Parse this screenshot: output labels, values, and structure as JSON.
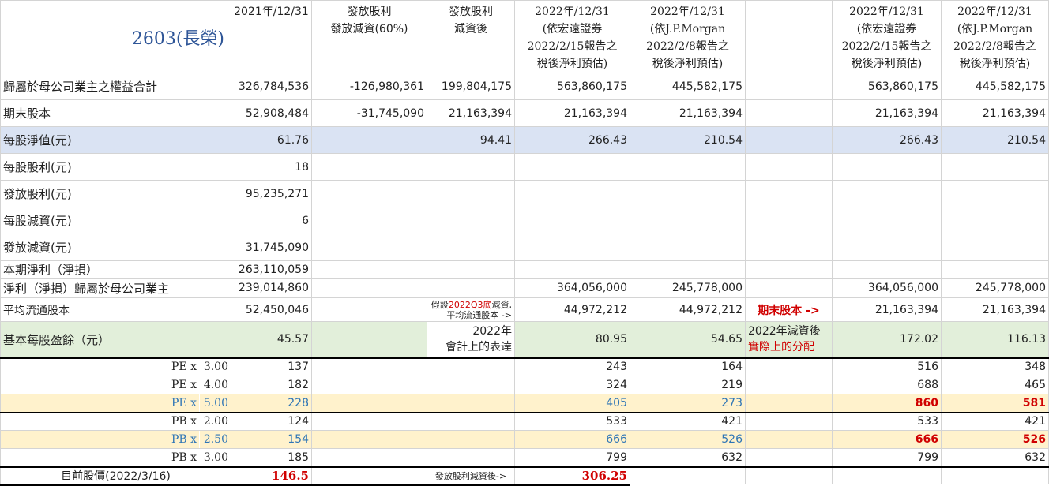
{
  "title": "2603(長榮)",
  "headers": [
    "2021年/12/31",
    "發放股利\n發放減資(60%)",
    "發放股利\n減資後",
    "2022年/12/31\n(依宏遠證券\n2022/2/15報告之\n稅後淨利預估)",
    "2022年/12/31\n(依J.P.Morgan\n2022/2/8報告之\n稅後淨利預估)",
    "",
    "2022年/12/31\n(依宏遠證券\n2022/2/15報告之\n稅後淨利預估)",
    "2022年/12/31\n(依J.P.Morgan\n2022/2/8報告之\n稅後淨利預估)"
  ],
  "rows": [
    {
      "label": "歸屬於母公司業主之權益合計",
      "cells": [
        "326,784,536",
        "-126,980,361",
        "199,804,175",
        "563,860,175",
        "445,582,175",
        "",
        "563,860,175",
        "445,582,175"
      ]
    },
    {
      "label": "期末股本",
      "cells": [
        "52,908,484",
        "-31,745,090",
        "21,163,394",
        "21,163,394",
        "21,163,394",
        "",
        "21,163,394",
        "21,163,394"
      ]
    },
    {
      "label": "每股淨值(元)",
      "cells": [
        "61.76",
        "",
        "94.41",
        "266.43",
        "210.54",
        "",
        "266.43",
        "210.54"
      ]
    },
    {
      "label": "每股股利(元)",
      "cells": [
        "18",
        "",
        "",
        "",
        "",
        "",
        "",
        ""
      ]
    },
    {
      "label": "發放股利(元)",
      "cells": [
        "95,235,271",
        "",
        "",
        "",
        "",
        "",
        "",
        ""
      ]
    },
    {
      "label": "每股減資(元)",
      "cells": [
        "6",
        "",
        "",
        "",
        "",
        "",
        "",
        ""
      ]
    },
    {
      "label": "發放減資(元)",
      "cells": [
        "31,745,090",
        "",
        "",
        "",
        "",
        "",
        "",
        ""
      ]
    },
    {
      "label": "本期淨利（淨損）",
      "cells": [
        "263,110,059",
        "",
        "",
        "",
        "",
        "",
        "",
        ""
      ]
    },
    {
      "label": "淨利（淨損）歸屬於母公司業主",
      "cells": [
        "239,014,860",
        "",
        "",
        "364,056,000",
        "245,778,000",
        "",
        "364,056,000",
        "245,778,000"
      ]
    }
  ],
  "avg_shares": {
    "label": "平均流通股本",
    "base": "52,450,046",
    "note_prefix": "假設",
    "note_red": "2022Q3底",
    "note_suffix": "減資,",
    "note_line2": "平均流通股本 ->",
    "v1": "44,972,212",
    "v2": "44,972,212",
    "end_label": "期末股本 ->",
    "v3": "21,163,394",
    "v4": "21,163,394"
  },
  "eps": {
    "label": "基本每股盈餘（元）",
    "base": "45.57",
    "note_line1": "2022年",
    "note_line2": "會計上的表達",
    "v1": "80.95",
    "v2": "54.65",
    "after_line1": "2022年減資後",
    "after_line2": "實際上的分配",
    "v3": "172.02",
    "v4": "116.13"
  },
  "pe_rows": [
    {
      "label": "PE x",
      "mult": "3.00",
      "base": "137",
      "v1": "243",
      "v2": "164",
      "v3": "516",
      "v4": "348",
      "hl": false
    },
    {
      "label": "PE x",
      "mult": "4.00",
      "base": "182",
      "v1": "324",
      "v2": "219",
      "v3": "688",
      "v4": "465",
      "hl": false
    },
    {
      "label": "PE x",
      "mult": "5.00",
      "base": "228",
      "v1": "405",
      "v2": "273",
      "v3": "860",
      "v4": "581",
      "hl": true
    }
  ],
  "pb_rows": [
    {
      "label": "PB x",
      "mult": "2.00",
      "base": "124",
      "v1": "533",
      "v2": "421",
      "v3": "533",
      "v4": "421",
      "hl": false
    },
    {
      "label": "PB x",
      "mult": "2.50",
      "base": "154",
      "v1": "666",
      "v2": "526",
      "v3": "666",
      "v4": "526",
      "hl": true
    },
    {
      "label": "PB x",
      "mult": "3.00",
      "base": "185",
      "v1": "799",
      "v2": "632",
      "v3": "799",
      "v4": "632",
      "hl": false
    }
  ],
  "price": {
    "label": "目前股價(2022/3/16)",
    "value": "146.5",
    "after_label": "發放股利減資後->",
    "after_value": "306.25"
  }
}
